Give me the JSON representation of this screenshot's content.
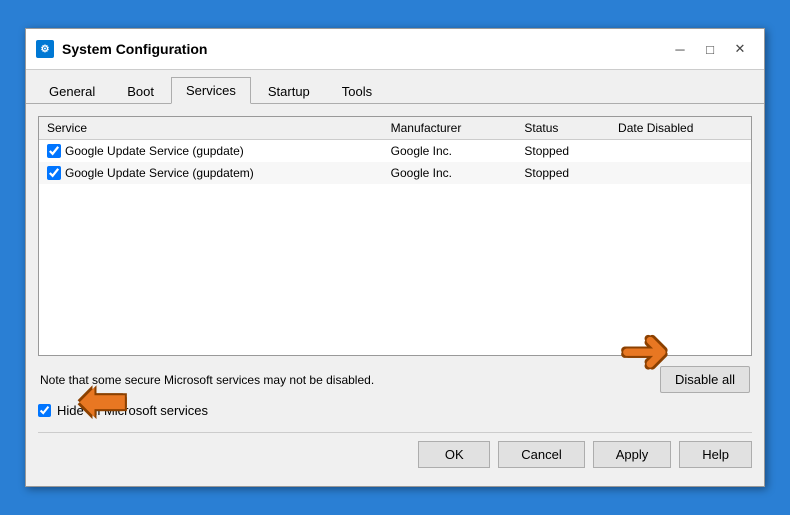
{
  "window": {
    "title": "System Configuration",
    "icon_label": "SC",
    "close_btn": "✕",
    "minimize_btn": "─",
    "maximize_btn": "□"
  },
  "tabs": [
    {
      "id": "general",
      "label": "General",
      "active": false
    },
    {
      "id": "boot",
      "label": "Boot",
      "active": false
    },
    {
      "id": "services",
      "label": "Services",
      "active": true
    },
    {
      "id": "startup",
      "label": "Startup",
      "active": false
    },
    {
      "id": "tools",
      "label": "Tools",
      "active": false
    }
  ],
  "table": {
    "columns": [
      {
        "id": "service",
        "label": "Service"
      },
      {
        "id": "manufacturer",
        "label": "Manufacturer"
      },
      {
        "id": "status",
        "label": "Status"
      },
      {
        "id": "date_disabled",
        "label": "Date Disabled"
      }
    ],
    "rows": [
      {
        "service": "Google Update Service (gupdate)",
        "manufacturer": "Google Inc.",
        "status": "Stopped",
        "date_disabled": "",
        "checked": true
      },
      {
        "service": "Google Update Service (gupdatem)",
        "manufacturer": "Google Inc.",
        "status": "Stopped",
        "date_disabled": "",
        "checked": true
      }
    ]
  },
  "note": "Note that some secure Microsoft services may not be disabled.",
  "disable_all_label": "Disable all",
  "hide_ms_label": "Hide all Microsoft services",
  "hide_ms_checked": true,
  "buttons": {
    "ok": "OK",
    "cancel": "Cancel",
    "apply": "Apply",
    "help": "Help"
  }
}
